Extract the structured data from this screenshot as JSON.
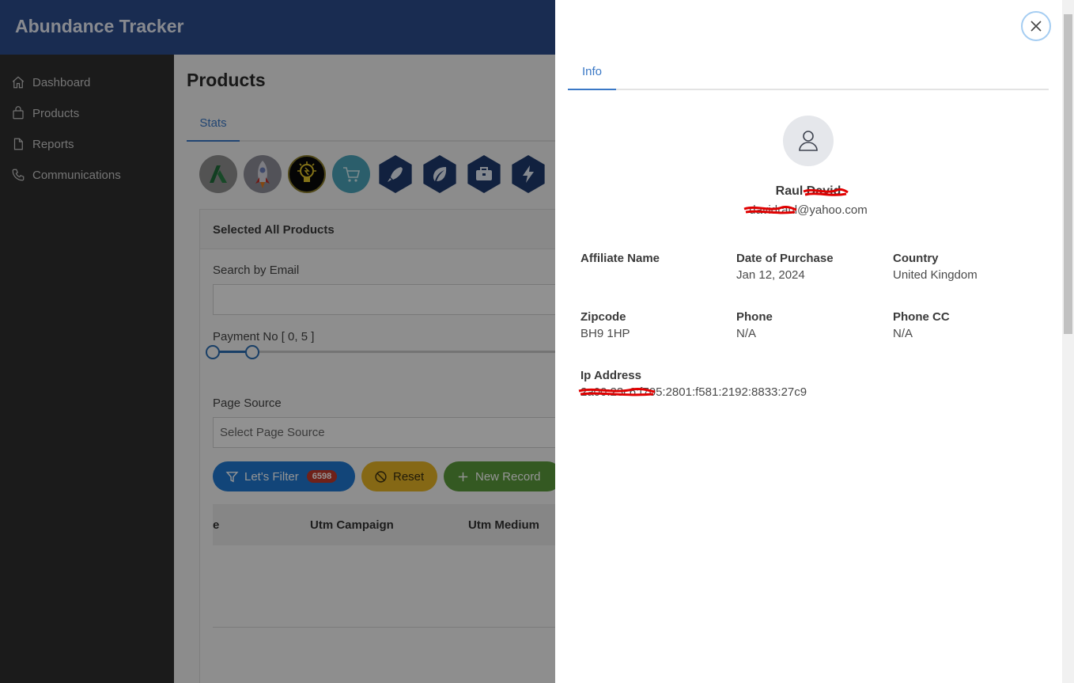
{
  "app": {
    "title": "Abundance Tracker"
  },
  "sidebar": {
    "items": [
      {
        "label": "Dashboard",
        "icon": "home-icon"
      },
      {
        "label": "Products",
        "icon": "bag-icon"
      },
      {
        "label": "Reports",
        "icon": "file-icon"
      },
      {
        "label": "Communications",
        "icon": "phone-icon"
      }
    ]
  },
  "main": {
    "title": "Products",
    "tab": "Stats",
    "card_title": "Selected All Products",
    "search_label": "Search by Email",
    "payment_label": "Payment No [ 0, 5 ]",
    "page_source_label": "Page Source",
    "page_source_placeholder": "Select Page Source",
    "buttons": {
      "filter": "Let's Filter",
      "filter_count": "6598",
      "reset": "Reset",
      "new_record": "New Record"
    },
    "table_headers": [
      "e",
      "Utm Campaign",
      "Utm Medium"
    ]
  },
  "drawer": {
    "tab": "Info",
    "user": {
      "name": "Raul David",
      "email": "davidraul@yahoo.com"
    },
    "fields": {
      "affiliate_name": {
        "label": "Affiliate Name",
        "value": ""
      },
      "date_of_purchase": {
        "label": "Date of Purchase",
        "value": "Jan 12, 2024"
      },
      "country": {
        "label": "Country",
        "value": "United Kingdom"
      },
      "zipcode": {
        "label": "Zipcode",
        "value": "BH9 1HP"
      },
      "phone": {
        "label": "Phone",
        "value": "N/A"
      },
      "phone_cc": {
        "label": "Phone CC",
        "value": "N/A"
      },
      "ip_address": {
        "label": "Ip Address",
        "value": "2a00:23c6:f705:2801:f581:2192:8833:27c9"
      }
    }
  },
  "colors": {
    "header": "#2b4c8c",
    "sidebar": "#2f2f2f",
    "accent": "#3a78c6",
    "filter_button": "#1f78d1",
    "reset_button": "#e6b325",
    "new_record_button": "#5b9a3c",
    "redaction": "#e00000"
  }
}
